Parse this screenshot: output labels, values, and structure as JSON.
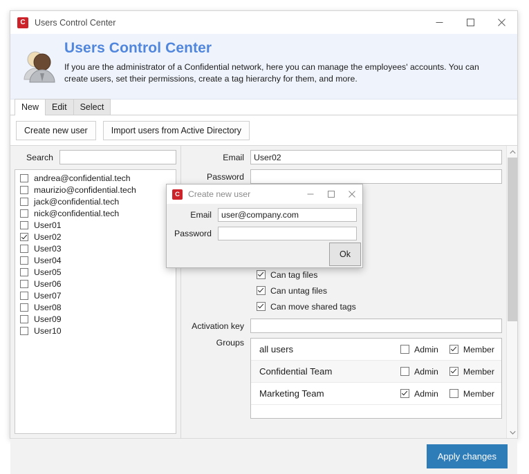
{
  "window": {
    "title": "Users Control Center",
    "icon": "app-c-icon",
    "controls": {
      "minimize": "minimize-icon",
      "maximize": "maximize-icon",
      "close": "close-icon"
    }
  },
  "banner": {
    "icon": "users-avatar-icon",
    "title": "Users Control Center",
    "description": "If you are the administrator of a Confidential network, here you can manage the employees' accounts. You can create users, set their permissions, create a tag hierarchy for them, and more.",
    "title_color": "#5186dd",
    "background_color": "#eff3fb"
  },
  "tabs": [
    {
      "label": "New",
      "active": true
    },
    {
      "label": "Edit",
      "active": false
    },
    {
      "label": "Select",
      "active": false
    }
  ],
  "toolbar": {
    "create_user_label": "Create new user",
    "import_ad_label": "Import users from Active Directory"
  },
  "left_pane": {
    "search_label": "Search",
    "search_value": "",
    "search_placeholder": "",
    "users": [
      {
        "label": "andrea@confidential.tech",
        "checked": false
      },
      {
        "label": "maurizio@confidential.tech",
        "checked": false
      },
      {
        "label": "jack@confidential.tech",
        "checked": false
      },
      {
        "label": "nick@confidential.tech",
        "checked": false
      },
      {
        "label": "User01",
        "checked": false
      },
      {
        "label": "User02",
        "checked": true
      },
      {
        "label": "User03",
        "checked": false
      },
      {
        "label": "User04",
        "checked": false
      },
      {
        "label": "User05",
        "checked": false
      },
      {
        "label": "User06",
        "checked": false
      },
      {
        "label": "User07",
        "checked": false
      },
      {
        "label": "User08",
        "checked": false
      },
      {
        "label": "User09",
        "checked": false
      },
      {
        "label": "User10",
        "checked": false
      }
    ]
  },
  "form": {
    "email_label": "Email",
    "email_value": "User02",
    "password_label": "Password",
    "password_value": "",
    "permissions": [
      {
        "label": "Can tag files",
        "checked": true
      },
      {
        "label": "Can untag files",
        "checked": true
      },
      {
        "label": "Can move shared tags",
        "checked": true
      }
    ],
    "activation_key_label": "Activation key",
    "activation_key_value": "",
    "groups_label": "Groups",
    "admin_label": "Admin",
    "member_label": "Member",
    "groups": [
      {
        "name": "all users",
        "admin": false,
        "member": true
      },
      {
        "name": "Confidential Team",
        "admin": false,
        "member": true
      },
      {
        "name": "Marketing Team",
        "admin": true,
        "member": false
      }
    ]
  },
  "footer": {
    "apply_label": "Apply changes",
    "apply_color": "#2e7cb8"
  },
  "dialog": {
    "title": "Create new user",
    "icon": "app-c-icon",
    "email_label": "Email",
    "email_value": "user@company.com",
    "password_label": "Password",
    "password_value": "",
    "ok_label": "Ok"
  }
}
